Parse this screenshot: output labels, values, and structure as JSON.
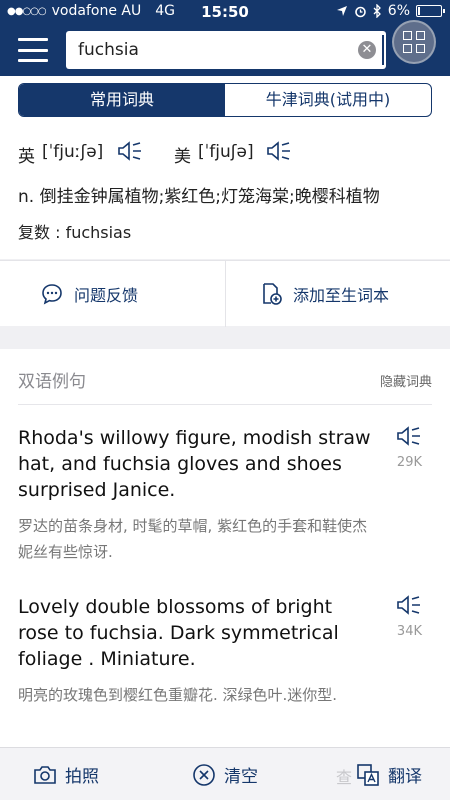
{
  "status_bar": {
    "signal": "●●○○○",
    "carrier": "vodafone AU",
    "network": "4G",
    "time": "15:50",
    "battery": "6%"
  },
  "search": {
    "query": "fuchsia",
    "clear_icon": "x-circle-icon",
    "menu_icon": "hamburger-icon"
  },
  "tabs": [
    {
      "label": "常用词典",
      "active": true
    },
    {
      "label": "牛津词典(试用中)",
      "active": false
    }
  ],
  "entry": {
    "uk_label": "英",
    "uk_phonetic": "[ˈfjuːʃə]",
    "us_label": "美",
    "us_phonetic": "[ˈfjuʃə]",
    "definition": "n. 倒挂金钟属植物;紫红色;灯笼海棠;晚樱科植物",
    "plural": "复数 : fuchsias"
  },
  "actions": {
    "feedback": "问题反馈",
    "add_wordbook": "添加至生词本"
  },
  "examples": {
    "title": "双语例句",
    "hide_label": "隐藏词典",
    "items": [
      {
        "en": "Rhoda's willowy figure, modish straw hat, and fuchsia gloves and shoes surprised Janice.",
        "zh": "罗达的苗条身材, 时髦的草帽, 紫红色的手套和鞋使杰妮丝有些惊讶.",
        "count": "29K"
      },
      {
        "en": "Lovely double blossoms of bright rose to fuchsia. Dark symmetrical foliage . Miniature.",
        "zh": "明亮的玫瑰色到樱红色重瓣花. 深绿色叶.迷你型.",
        "count": "34K"
      }
    ]
  },
  "bottom_bar": {
    "photo": "拍照",
    "clear": "清空",
    "translate": "翻译",
    "ghost_text": "查"
  },
  "colors": {
    "brand": "#15376b",
    "background": "#f0f0f3"
  }
}
